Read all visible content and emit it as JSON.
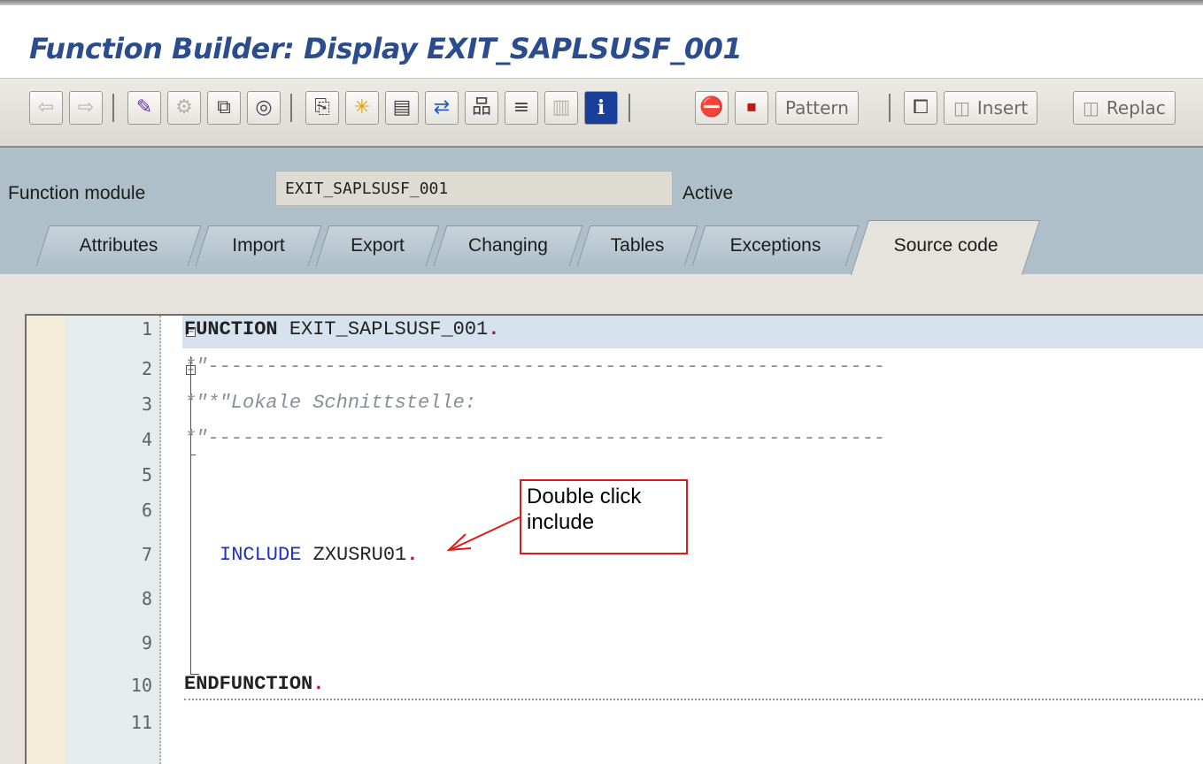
{
  "window": {
    "title": "Function Builder: Display EXIT_SAPLSUSF_001"
  },
  "toolbar": {
    "icons": [
      {
        "name": "back-arrow-icon",
        "glyph": "⇦"
      },
      {
        "name": "forward-arrow-icon",
        "glyph": "⇨"
      },
      {
        "name": "display-change-icon",
        "glyph": "✎"
      },
      {
        "name": "active-inactive-icon",
        "glyph": "⚙"
      },
      {
        "name": "other-object-icon",
        "glyph": "⧉"
      },
      {
        "name": "check-icon",
        "glyph": "◎"
      },
      {
        "name": "activate-icon",
        "glyph": "⎘"
      },
      {
        "name": "where-used-icon",
        "glyph": "✳"
      },
      {
        "name": "display-object-list-icon",
        "glyph": "▤"
      },
      {
        "name": "navigation-window-icon",
        "glyph": "⇄"
      },
      {
        "name": "hierarchy-icon",
        "glyph": "品"
      },
      {
        "name": "stack-icon",
        "glyph": "≡"
      },
      {
        "name": "list-icon",
        "glyph": "▥"
      },
      {
        "name": "info-icon",
        "glyph": "i"
      },
      {
        "name": "set-breakpoint-icon",
        "glyph": "⛔"
      },
      {
        "name": "set-session-breakpoint-icon",
        "glyph": "⏹"
      }
    ],
    "pattern_label": "Pattern",
    "insert_label": "Insert",
    "replace_label": "Replac",
    "pretty_printer_icon": "⧠",
    "insert_icon": "◫",
    "replace_icon": "◫"
  },
  "header": {
    "function_module_label": "Function module",
    "function_module_value": "EXIT_SAPLSUSF_001",
    "status": "Active"
  },
  "tabs": [
    {
      "label": "Attributes"
    },
    {
      "label": "Import"
    },
    {
      "label": "Export"
    },
    {
      "label": "Changing"
    },
    {
      "label": "Tables"
    },
    {
      "label": "Exceptions"
    },
    {
      "label": "Source code"
    }
  ],
  "editor": {
    "line_numbers": [
      "1",
      "2",
      "3",
      "4",
      "5",
      "6",
      "7",
      "8",
      "9",
      "10",
      "11"
    ],
    "line1_keyword": "FUNCTION",
    "line1_name": " EXIT_SAPLSUSF_001",
    "line2": "*\"----------------------------------------------------------",
    "line3": "*\"*\"Lokale Schnittstelle:",
    "line4": "*\"----------------------------------------------------------",
    "line7_keyword": "INCLUDE",
    "line7_name": " ZXUSRU01",
    "line10_keyword": "ENDFUNCTION",
    "period": "."
  },
  "annotation": {
    "line1": "Double click",
    "line2": "include",
    "color": "#e01818"
  }
}
